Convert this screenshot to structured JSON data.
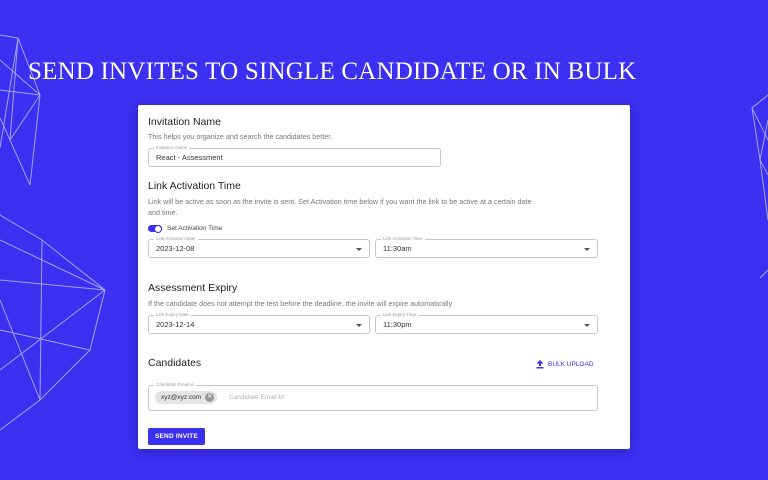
{
  "hero": {
    "title": "SEND INVITES TO SINGLE CANDIDATE OR IN BULK"
  },
  "invitation": {
    "title": "Invitation Name",
    "desc": "This helps you organize and search the candidates better.",
    "field_label": "Invitation Name",
    "field_value": "React - Assessment"
  },
  "activation": {
    "title": "Link Activation Time",
    "desc_line1": "Link will be active as soon as the invite is sent. Set Activation time below if you want the link to be active at a certain date",
    "desc_line2": "and time.",
    "toggle_label": "Set Activation Time",
    "toggle_on": true,
    "date_label": "Link Activation Date",
    "date_value": "2023-12-08",
    "time_label": "Link Activation Time",
    "time_value": "11:30am"
  },
  "expiry": {
    "title": "Assessment Expiry",
    "desc": "If the candidate does not attempt the test before the deadline, the invite will expire automatically",
    "date_label": "Link Expiry Date",
    "date_value": "2023-12-14",
    "time_label": "Link Expiry Time",
    "time_value": "11:30pm"
  },
  "candidates": {
    "title": "Candidates",
    "bulk_upload_label": "BULK UPLOAD",
    "field_label": "Candidate Email Id",
    "chip": "xyz@xyz.com",
    "placeholder": "Candidate Email Id"
  },
  "actions": {
    "send_label": "SEND INVITE"
  },
  "colors": {
    "accent": "#3b2ff0",
    "card": "#ffffff",
    "title_text": "#ffffff"
  },
  "icons": {
    "upload": "upload-icon",
    "dropdown": "caret-down-icon",
    "chip_remove": "close-icon"
  }
}
